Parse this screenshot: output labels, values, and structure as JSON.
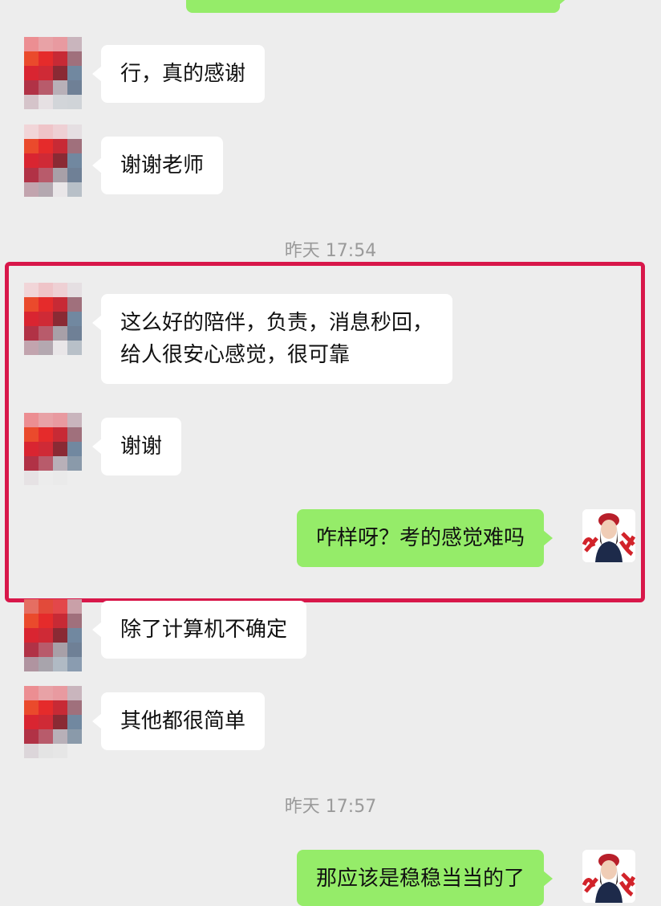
{
  "messages": [
    {
      "text": "行，真的感谢"
    },
    {
      "text": "谢谢老师"
    },
    {
      "lines": [
        "这么好的陪伴，负责，消息秒回，",
        "给人很安心感觉，很可靠"
      ]
    },
    {
      "text": "谢谢"
    },
    {
      "text": "咋样呀？考的感觉难吗"
    },
    {
      "text": "除了计算机不确定"
    },
    {
      "text": "其他都很简单"
    },
    {
      "text": "那应该是稳稳当当的了"
    }
  ],
  "timestamps": [
    "昨天 17:54",
    "昨天 17:57"
  ],
  "colors": {
    "background": "#ededed",
    "incoming_bubble": "#ffffff",
    "outgoing_bubble": "#95ec69",
    "highlight_border": "#d8174a",
    "timestamp_text": "#9a9a9a"
  }
}
